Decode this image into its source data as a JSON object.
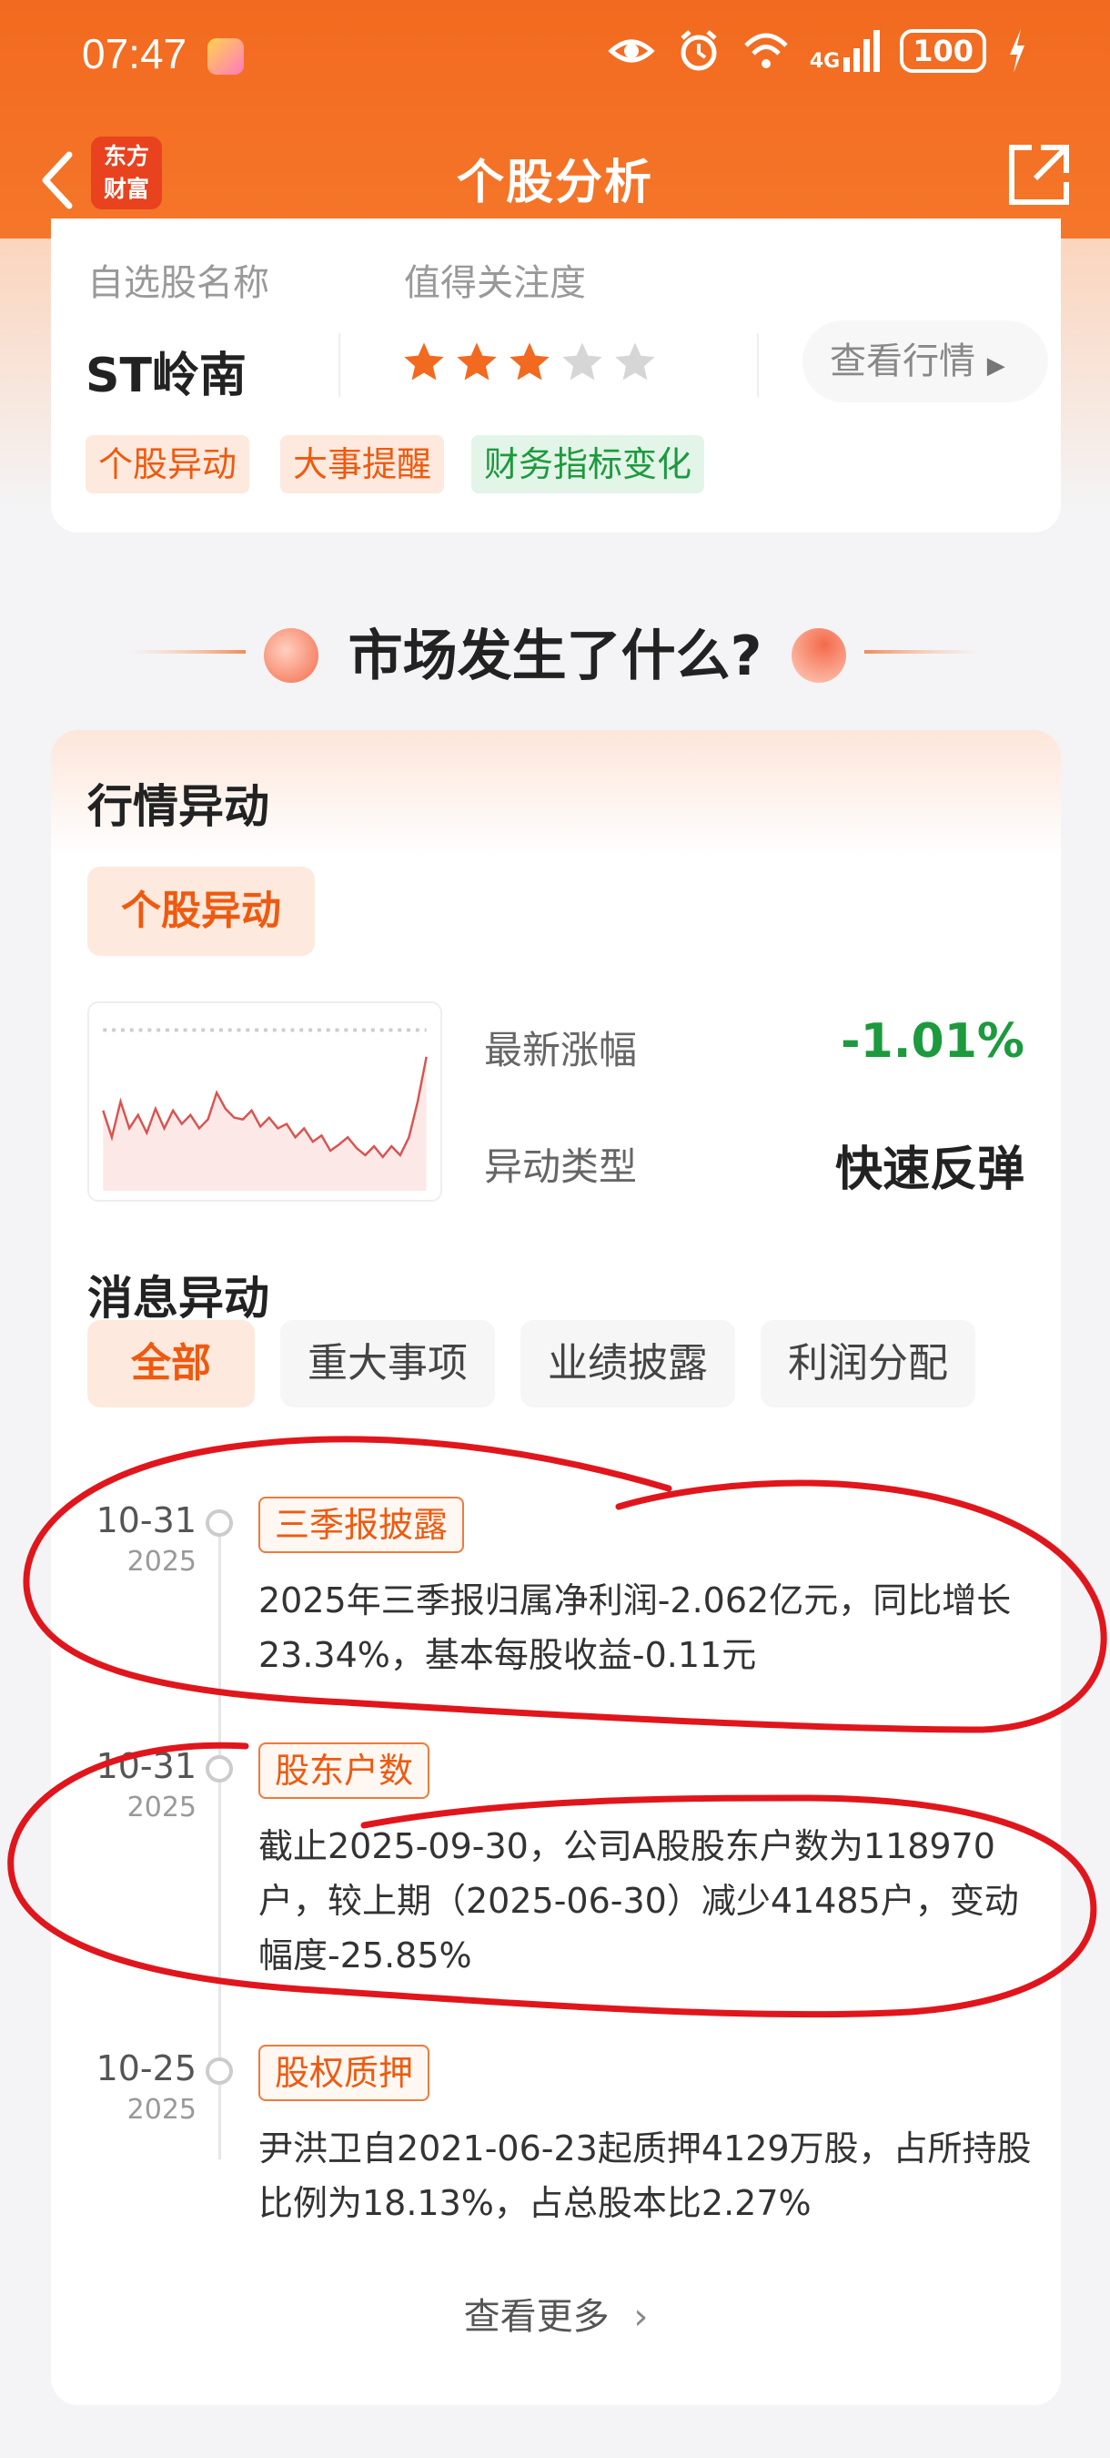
{
  "status_bar": {
    "time": "07:47",
    "network": "4G",
    "battery": "100"
  },
  "nav": {
    "title": "个股分析",
    "logo_line1": "东方",
    "logo_line2": "财富"
  },
  "stock_card": {
    "name_header": "自选股名称",
    "attention_header": "值得关注度",
    "stock_name": "ST岭南",
    "rating_stars": 3,
    "rating_max": 5,
    "view_quote": "查看行情",
    "tags": [
      "个股异动",
      "大事提醒",
      "财务指标变化"
    ]
  },
  "section": {
    "title": "市场发生了什么?"
  },
  "market": {
    "heading": "行情异动",
    "pill": "个股异动",
    "latest_change_label": "最新涨幅",
    "latest_change_value": "-1.01%",
    "anomaly_type_label": "异动类型",
    "anomaly_type_value": "快速反弹"
  },
  "news": {
    "heading": "消息异动",
    "tabs": [
      "全部",
      "重大事项",
      "业绩披露",
      "利润分配"
    ],
    "events": [
      {
        "date": "10-31",
        "year": "2025",
        "tag": "三季报披露",
        "text": "2025年三季报归属净利润-2.062亿元，同比增长23.34%，基本每股收益-0.11元"
      },
      {
        "date": "10-31",
        "year": "2025",
        "tag": "股东户数",
        "text": "截止2025-09-30，公司A股股东户数为118970户，较上期（2025-06-30）减少41485户，变动幅度-25.85%"
      },
      {
        "date": "10-25",
        "year": "2025",
        "tag": "股权质押",
        "text": "尹洪卫自2021-06-23起质押4129万股，占所持股比例为18.13%，占总股本比2.27%"
      }
    ],
    "more": "查看更多"
  },
  "colors": {
    "brand": "#f26a1f",
    "down": "#1c9a3d",
    "scribble": "#e0161c"
  }
}
